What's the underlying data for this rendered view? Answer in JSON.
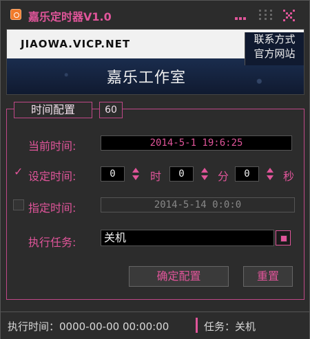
{
  "window": {
    "title": "嘉乐定时器V1.0"
  },
  "banner": {
    "url": "JIAOWA.VICP.NET",
    "contact_label": "联系方式",
    "site_label": "官方网站",
    "studio_name": "嘉乐工作室"
  },
  "config": {
    "group_title": "时间配置",
    "group_count": "60",
    "current_time_label": "当前时间:",
    "current_time_value": "2014-5-1 19:6:25",
    "set_time_label": "设定时间:",
    "set_time_checked": true,
    "hours_value": "0",
    "hours_unit": "时",
    "minutes_value": "0",
    "minutes_unit": "分",
    "seconds_value": "0",
    "seconds_unit": "秒",
    "specified_time_label": "指定时间:",
    "specified_time_checked": false,
    "specified_time_value": "2014-5-14 0:0:0",
    "task_label": "执行任务:",
    "task_value": "关机",
    "confirm_button": "确定配置",
    "reset_button": "重置"
  },
  "status": {
    "exec_time": "执行时间：0000-00-00 00:00:00",
    "task": "任务：关机"
  },
  "colors": {
    "accent": "#e0559a",
    "background": "#2c2c2c",
    "field_bg": "#000000"
  },
  "icons": {
    "app": "timer-app-icon",
    "menu": "menu-dots-icon",
    "minimize": "minimize-icon",
    "close": "close-icon",
    "task_dropdown": "dropdown-square-icon"
  }
}
